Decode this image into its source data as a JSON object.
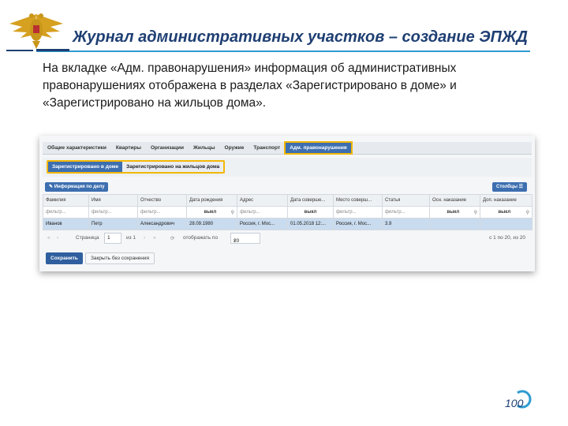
{
  "slide": {
    "title": "Журнал административных участков – создание ЭПЖД",
    "intro": "На вкладке «Адм. правонарушения» информация об административных правонарушениях отображена в разделах «Зарегистрировано в доме» и «Зарегистрировано на жильцов дома».",
    "page_number": "100"
  },
  "app": {
    "tabs": [
      "Общие характеристики",
      "Квартиры",
      "Организации",
      "Жильцы",
      "Оружие",
      "Транспорт",
      "Адм. правонарушения"
    ],
    "subtabs": [
      "Зарегистрировано в доме",
      "Зарегистрировано на жильцов дома"
    ],
    "info_button": "Информация по делу",
    "columns_button": "Столбцы",
    "table": {
      "headers": [
        "Фамилия",
        "Имя",
        "Отчество",
        "Дата рождения",
        "Адрес",
        "Дата соверше...",
        "Место соверш...",
        "Статья",
        "Осн. наказание",
        "Доп. наказание"
      ],
      "filters": [
        "фильтр...",
        "фильтр...",
        "фильтр...",
        "выкл",
        "фильтр...",
        "выкл",
        "фильтр...",
        "фильтр...",
        "выкл",
        "выкл"
      ],
      "rows": [
        [
          "Иванов",
          "Петр",
          "Александрович",
          "28.09.1980",
          "Россия, г. Мос...",
          "01.05.2018 12:...",
          "Россия, г. Мос...",
          "3.9",
          "",
          ""
        ]
      ]
    },
    "pager": {
      "page_label": "Страница",
      "page_value": "1",
      "of_label": "из 1",
      "show_label": "отображать по",
      "page_size": "20",
      "range": "с 1 по 20, из 20"
    },
    "save_button": "Сохранить",
    "close_button": "Закрыть без сохранения"
  },
  "colors": {
    "title": "#1f3f73",
    "accent_line": "#2f9bd0",
    "highlight": "#f2b705",
    "app_blue": "#3d6fb0"
  }
}
